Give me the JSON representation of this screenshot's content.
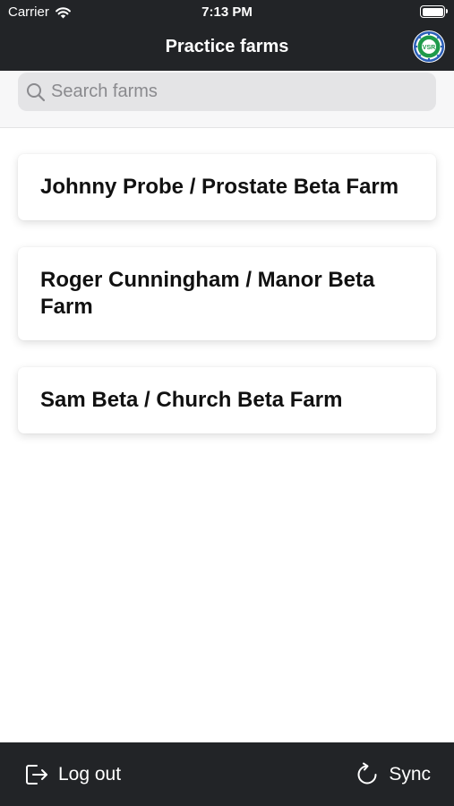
{
  "status_bar": {
    "carrier": "Carrier",
    "time": "7:13 PM"
  },
  "header": {
    "title": "Practice farms",
    "logo_text": "VSR"
  },
  "search": {
    "placeholder": "Search farms",
    "value": ""
  },
  "farms": [
    {
      "label": "Johnny Probe / Prostate Beta Farm"
    },
    {
      "label": "Roger Cunningham / Manor Beta Farm"
    },
    {
      "label": "Sam Beta / Church Beta Farm"
    }
  ],
  "footer": {
    "logout_label": "Log out",
    "sync_label": "Sync"
  },
  "icons": {
    "search": "search-icon",
    "logout": "logout-icon",
    "sync": "sync-icon",
    "wifi": "wifi-icon",
    "battery": "battery-icon"
  },
  "colors": {
    "bar_bg": "#222427",
    "search_bg": "#e4e4e6",
    "logo_green": "#1e9a4a",
    "logo_blue": "#2b5fb8"
  }
}
